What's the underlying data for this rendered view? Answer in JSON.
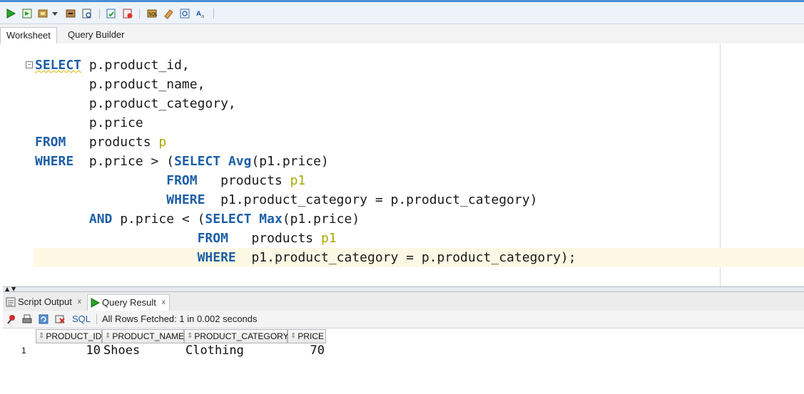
{
  "toolbar": {
    "icons": [
      "run-statement-icon",
      "run-script-icon",
      "commit-icon",
      "dropdown-icon",
      "rollback-icon",
      "explain-plan-icon",
      "autotrace-icon",
      "sql-tuning-icon",
      "clear-icon",
      "sql-history-icon",
      "eraser-icon",
      "format-icon",
      "find-replace-icon"
    ]
  },
  "worksheet_tabs": {
    "worksheet": "Worksheet",
    "query_builder": "Query Builder"
  },
  "editor": {
    "lines": [
      {
        "seg": [
          {
            "t": "SELECT",
            "k": "kwsq"
          },
          {
            "t": " p.product_id,",
            "k": ""
          }
        ]
      },
      {
        "seg": [
          {
            "t": "       p.product_name,",
            "k": ""
          }
        ]
      },
      {
        "seg": [
          {
            "t": "       p.product_category,",
            "k": ""
          }
        ]
      },
      {
        "seg": [
          {
            "t": "       p.price",
            "k": ""
          }
        ]
      },
      {
        "seg": [
          {
            "t": "FROM",
            "k": "kw"
          },
          {
            "t": "   products ",
            "k": ""
          },
          {
            "t": "p",
            "k": "al"
          }
        ]
      },
      {
        "seg": [
          {
            "t": "WHERE",
            "k": "kw"
          },
          {
            "t": "  p.price > (",
            "k": ""
          },
          {
            "t": "SELECT",
            "k": "kw"
          },
          {
            "t": " ",
            "k": ""
          },
          {
            "t": "Avg",
            "k": "kw"
          },
          {
            "t": "(p1.price)",
            "k": ""
          }
        ]
      },
      {
        "seg": [
          {
            "t": "                 ",
            "k": ""
          },
          {
            "t": "FROM",
            "k": "kw"
          },
          {
            "t": "   products ",
            "k": ""
          },
          {
            "t": "p1",
            "k": "al"
          }
        ]
      },
      {
        "seg": [
          {
            "t": "                 ",
            "k": ""
          },
          {
            "t": "WHERE",
            "k": "kw"
          },
          {
            "t": "  p1.product_category = p.product_category)",
            "k": ""
          }
        ]
      },
      {
        "seg": [
          {
            "t": "       ",
            "k": ""
          },
          {
            "t": "AND",
            "k": "kw"
          },
          {
            "t": " p.price < (",
            "k": ""
          },
          {
            "t": "SELECT",
            "k": "kw"
          },
          {
            "t": " ",
            "k": ""
          },
          {
            "t": "Max",
            "k": "kw"
          },
          {
            "t": "(p1.price)",
            "k": ""
          }
        ]
      },
      {
        "seg": [
          {
            "t": "                     ",
            "k": ""
          },
          {
            "t": "FROM",
            "k": "kw"
          },
          {
            "t": "   products ",
            "k": ""
          },
          {
            "t": "p1",
            "k": "al"
          }
        ]
      },
      {
        "seg": [
          {
            "t": "                     ",
            "k": ""
          },
          {
            "t": "WHERE",
            "k": "kw"
          },
          {
            "t": "  p1.product_category = p.product_category);",
            "k": ""
          }
        ]
      }
    ]
  },
  "output_tabs": {
    "script_output": "Script Output",
    "query_result": "Query Result",
    "close": "x"
  },
  "results_toolbar": {
    "sql_label": "SQL",
    "status": "All Rows Fetched: 1 in 0.002 seconds"
  },
  "grid": {
    "columns": [
      "PRODUCT_ID",
      "PRODUCT_NAME",
      "PRODUCT_CATEGORY",
      "PRICE"
    ],
    "rows": [
      {
        "num": "1",
        "cells": [
          "10",
          "Shoes",
          "Clothing",
          "70"
        ]
      }
    ]
  },
  "colors": {
    "keyword": "#1d5fa6",
    "alias": "#a7a900",
    "current_line": "#fdf8e4",
    "accent": "#4b8fd4"
  }
}
